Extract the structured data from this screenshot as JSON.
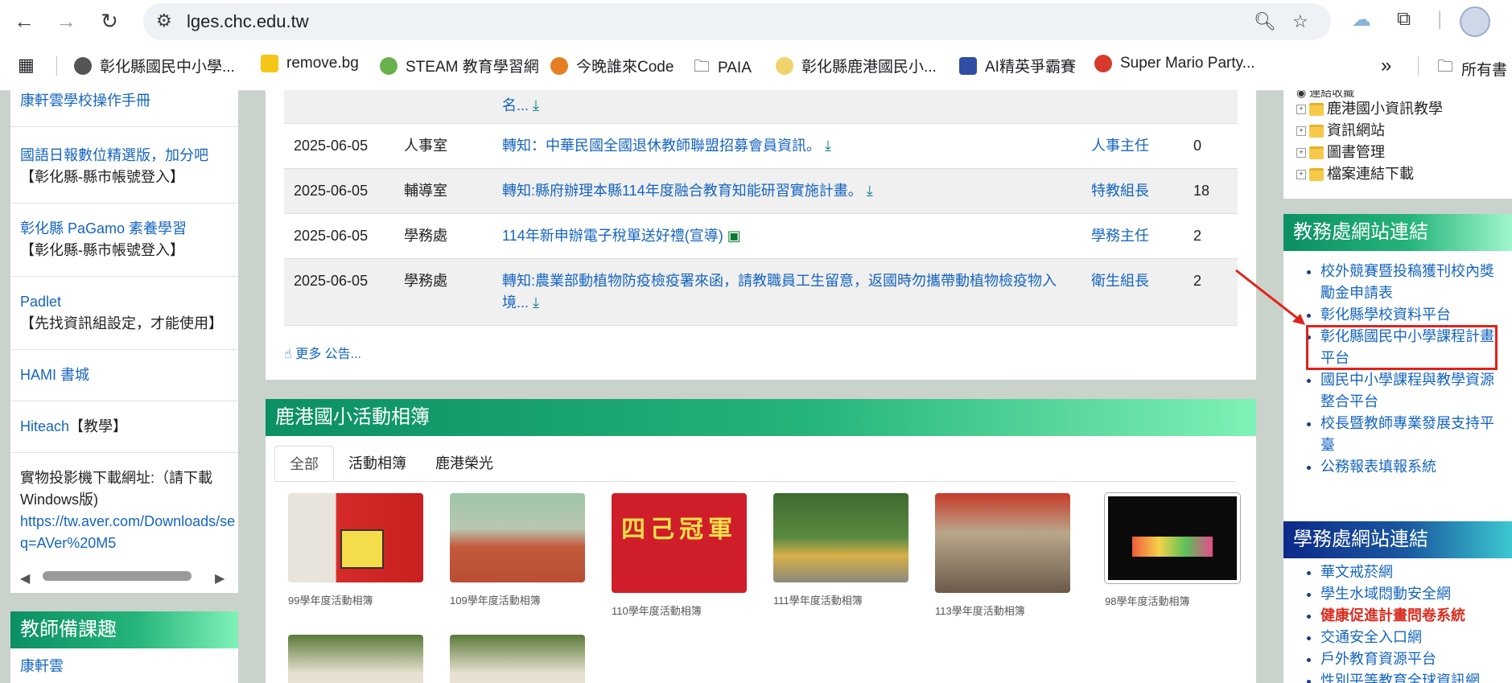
{
  "browser": {
    "url": "lges.chc.edu.tw",
    "bookmarks": [
      "彰化縣國民中小學...",
      "remove.bg",
      "STEAM 教育學習網",
      "今晚誰來Code",
      "PAIA",
      "彰化縣鹿港國民小...",
      "AI精英爭霸賽",
      "Super Mario Party...",
      "所有書"
    ],
    "more_glyph": "»"
  },
  "left": {
    "items": [
      {
        "link": "康軒雲學校操作手冊",
        "note": ""
      },
      {
        "link": "國語日報數位精選版，加分吧",
        "note": "【彰化縣-縣市帳號登入】"
      },
      {
        "link": "彰化縣 PaGamo 素養學習",
        "note": "【彰化縣-縣市帳號登入】"
      },
      {
        "link": "Padlet",
        "note": "【先找資訊組設定，才能使用】"
      },
      {
        "link": "HAMI 書城",
        "note": ""
      },
      {
        "link": "Hiteach",
        "note": "【教學】"
      }
    ],
    "projector_text": "實物投影機下載網址:（請下載Windows版)",
    "projector_link": "https://tw.aver.com/Downloads/se q=AVer%20M5",
    "section2_title": "教師備課趣",
    "section2_first": "康軒雲"
  },
  "announcements": {
    "rows": [
      {
        "date": "",
        "office": "",
        "title": "名...",
        "icon": "download",
        "author": "",
        "count": ""
      },
      {
        "date": "2025-06-05",
        "office": "人事室",
        "title": "轉知：中華民國全國退休教師聯盟招募會員資訊。",
        "icon": "download",
        "author": "人事主任",
        "count": "0"
      },
      {
        "date": "2025-06-05",
        "office": "輔導室",
        "title": "轉知:縣府辦理本縣114年度融合教育知能研習實施計畫。",
        "icon": "download",
        "author": "特教組長",
        "count": "18"
      },
      {
        "date": "2025-06-05",
        "office": "學務處",
        "title": "114年新申辦電子稅單送好禮(宣導)",
        "icon": "image",
        "author": "學務主任",
        "count": "2"
      },
      {
        "date": "2025-06-05",
        "office": "學務處",
        "title": "轉知:農業部動植物防疫檢疫署來函，請教職員工生留意，返國時勿攜帶動植物檢疫物入境...",
        "icon": "download",
        "author": "衛生組長",
        "count": "2"
      }
    ],
    "more": "更多 公告..."
  },
  "gallery": {
    "title": "鹿港國小活動相簿",
    "tabs": [
      "全部",
      "活動相簿",
      "鹿港榮光"
    ],
    "albums": [
      "99學年度活動相簿",
      "109學年度活動相簿",
      "110學年度活動相簿",
      "111學年度活動相簿",
      "113學年度活動相簿",
      "98學年度活動相簿",
      "",
      ""
    ],
    "banner_text": "四己冠軍"
  },
  "right": {
    "tree_top": "連結收藏",
    "tree": [
      "鹿港國小資訊教學",
      "資訊網站",
      "圖書管理",
      "檔案連結下載"
    ],
    "academic_title": "教務處網站連結",
    "academic_links": [
      "校外競賽暨投稿獲刊校內獎勵金申請表",
      "彰化縣學校資料平台",
      "彰化縣國民中小學課程計畫平台",
      "國民中小學課程與教學資源整合平台",
      "校長暨教師專業發展支持平臺",
      "公務報表填報系統"
    ],
    "student_title": "學務處網站連結",
    "student_links": [
      "華文戒菸網",
      "學生水域悶動安全網",
      "健康促進計畫問卷系統",
      "交通安全入口網",
      "戶外教育資源平台",
      "性別平等教育全球資訊網"
    ]
  }
}
